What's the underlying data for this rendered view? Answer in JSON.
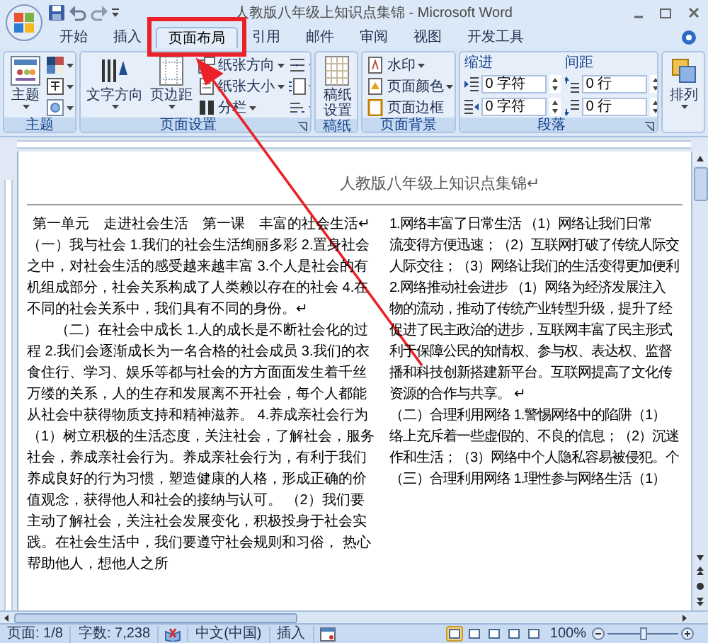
{
  "window": {
    "title": "人教版八年级上知识点集锦 - Microsoft Word"
  },
  "tabs": [
    {
      "label": "开始",
      "selected": false,
      "highlighted": false
    },
    {
      "label": "插入",
      "selected": false,
      "highlighted": false
    },
    {
      "label": "页面布局",
      "selected": true,
      "highlighted": true
    },
    {
      "label": "引用",
      "selected": false,
      "highlighted": false
    },
    {
      "label": "邮件",
      "selected": false,
      "highlighted": false
    },
    {
      "label": "审阅",
      "selected": false,
      "highlighted": false
    },
    {
      "label": "视图",
      "selected": false,
      "highlighted": false
    },
    {
      "label": "开发工具",
      "selected": false,
      "highlighted": false
    }
  ],
  "ribbon": {
    "groups": [
      {
        "label": "主题",
        "launcher": false,
        "columns": [
          [
            {
              "kind": "large",
              "label": "主题",
              "dropdown": true
            }
          ],
          [
            {
              "kind": "small",
              "dropdown": true
            },
            {
              "kind": "small",
              "dropdown": true
            },
            {
              "kind": "small",
              "dropdown": true
            }
          ]
        ]
      },
      {
        "label": "页面设置",
        "launcher": true,
        "columns": [
          [
            {
              "kind": "large",
              "label": "文字方向",
              "dropdown": true
            }
          ],
          [
            {
              "kind": "large",
              "label": "页边距",
              "dropdown": true
            }
          ],
          [
            {
              "kind": "small",
              "label": "纸张方向",
              "dropdown": true
            },
            {
              "kind": "small",
              "label": "纸张大小",
              "dropdown": true
            },
            {
              "kind": "small",
              "label": "分栏",
              "dropdown": true
            }
          ],
          [
            {
              "kind": "small",
              "dropdown": true
            },
            {
              "kind": "small",
              "dropdown": true
            },
            {
              "kind": "small",
              "dropdown": true
            }
          ]
        ]
      },
      {
        "label": "稿纸",
        "launcher": false,
        "columns": [
          [
            {
              "kind": "large",
              "label": "稿纸设置",
              "dropdown": false
            }
          ]
        ]
      },
      {
        "label": "页面背景",
        "launcher": false,
        "columns": [
          [
            {
              "kind": "small",
              "label": "水印",
              "dropdown": true
            },
            {
              "kind": "small",
              "label": "页面颜色",
              "dropdown": true
            },
            {
              "kind": "small",
              "label": "页面边框",
              "dropdown": false
            }
          ]
        ]
      },
      {
        "label": "段落",
        "launcher": true,
        "columns": [
          [
            {
              "kind": "header",
              "label": "缩进"
            },
            {
              "kind": "spinner",
              "value": "0 字符"
            },
            {
              "kind": "spinner",
              "value": "0 字符"
            }
          ],
          [
            {
              "kind": "header",
              "label": "间距"
            },
            {
              "kind": "spinner",
              "value": "0 行"
            },
            {
              "kind": "spinner",
              "value": "0 行"
            }
          ]
        ]
      },
      {
        "launcher": false,
        "columns": [
          [
            {
              "kind": "large",
              "label": "排列",
              "dropdown": true
            }
          ]
        ]
      }
    ]
  },
  "document": {
    "header": "人教版八年级上知识点集锦↵",
    "columns": [
      [
        {
          "kind": "heading",
          "text": "第一单元　走进社会生活　第一课　丰富的社会生活↵"
        },
        {
          "kind": "paragraph",
          "text": "（一）我与社会 1.我们的社会生活绚丽多彩 2.置身社会之中，对社会生活的感受越来越丰富 3.个人是社会的有机组成部分，社会关系构成了人类赖以存在的社会 4.在不同的社会关系中，我们具有不同的身份。↵"
        },
        {
          "kind": "indented",
          "text": "（二）在社会中成长 1.人的成长是不断社会化的过程 2.我们会逐渐成长为一名合格的社会成员 3.我们的衣食住行、学习、娱乐等都与社会的方方面面发生着千丝万缕的关系，人的生存和发展离不开社会，每个人都能从社会中获得物质支持和精神滋养。 4.养成亲社会行为（1）树立积极的生活态度，关注社会，了解社会，服务社会，养成亲社会行为。养成亲社会行为，有利于我们养成良好的行为习惯，塑造健康的人格，形成正确的价值观念，获得他人和社会的接纳与认可。 （2）我们要主动了解社会，关注社会发展变化，积极投身于社会实践。在社会生活中，我们要遵守社会规则和习俗， 热心帮助他人，想他人之所"
        }
      ],
      [
        {
          "kind": "line",
          "text": "1.网络丰富了日常生活 （1）网络让我们日常"
        },
        {
          "kind": "line",
          "text": "流变得方便迅速；（2）互联网打破了传统人际交"
        },
        {
          "kind": "line",
          "text": "人际交往；（3）网络让我们的生活变得更加便利"
        },
        {
          "kind": "line",
          "text": "2.网络推动社会进步 （1）网络为经济发展注入"
        },
        {
          "kind": "line",
          "text": "物的流动，推动了传统产业转型升级，提升了经"
        },
        {
          "kind": "line",
          "text": "促进了民主政治的进步，互联网丰富了民主形式"
        },
        {
          "kind": "line",
          "text": "利于保障公民的知情权、参与权、表达权、监督"
        },
        {
          "kind": "line",
          "text": "播和科技创新搭建新平台。互联网提高了文化传"
        },
        {
          "kind": "line",
          "text": "资源的合作与共享。 ↵"
        },
        {
          "kind": "line",
          "text": "（二）合理利用网络 1.警惕网络中的陷阱（1）"
        },
        {
          "kind": "line",
          "text": "络上充斥着一些虚假的、不良的信息；（2）沉迷"
        },
        {
          "kind": "line",
          "text": "作和生活；（3）网络中个人隐私容易被侵犯。个"
        },
        {
          "kind": "line",
          "text": "（三）合理利用网络 1.理性参与网络生活（1）"
        }
      ]
    ]
  },
  "status_bar": {
    "items": [
      {
        "kind": "text",
        "text": "页面: 1/8"
      },
      {
        "kind": "text",
        "text": "字数: 7,238"
      },
      {
        "kind": "proofing"
      },
      {
        "kind": "text",
        "text": "中文(中国)"
      },
      {
        "kind": "text",
        "text": "插入"
      },
      {
        "kind": "macro"
      }
    ],
    "views": [
      {
        "selected": true
      },
      {
        "selected": false
      },
      {
        "selected": false
      },
      {
        "selected": false
      },
      {
        "selected": false
      }
    ],
    "zoom": {
      "label": "100%",
      "level": 0.5
    }
  }
}
